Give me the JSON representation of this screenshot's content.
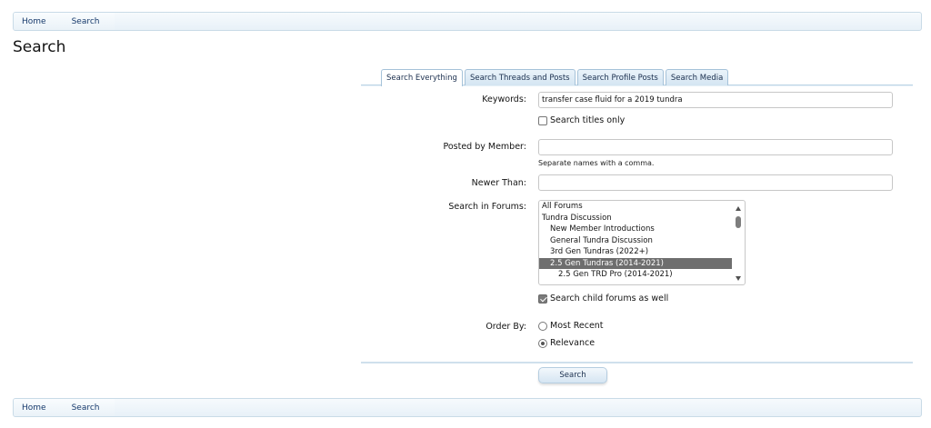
{
  "breadcrumb": {
    "home": "Home",
    "current": "Search"
  },
  "page_title": "Search",
  "tabs": [
    {
      "label": "Search Everything",
      "active": true
    },
    {
      "label": "Search Threads and Posts",
      "active": false
    },
    {
      "label": "Search Profile Posts",
      "active": false
    },
    {
      "label": "Search Media",
      "active": false
    }
  ],
  "form": {
    "keywords_label": "Keywords:",
    "keywords_value": "transfer case fluid for a 2019 tundra",
    "titles_only_label": "Search titles only",
    "titles_only_checked": false,
    "member_label": "Posted by Member:",
    "member_value": "",
    "member_hint": "Separate names with a comma.",
    "newer_label": "Newer Than:",
    "newer_value": "",
    "forums_label": "Search in Forums:",
    "forums": [
      {
        "label": "All Forums",
        "indent": 0,
        "selected": false
      },
      {
        "label": "Tundra Discussion",
        "indent": 0,
        "selected": false
      },
      {
        "label": "New Member Introductions",
        "indent": 1,
        "selected": false
      },
      {
        "label": "General Tundra Discussion",
        "indent": 1,
        "selected": false
      },
      {
        "label": "3rd Gen Tundras (2022+)",
        "indent": 1,
        "selected": false
      },
      {
        "label": "2.5 Gen Tundras (2014-2021)",
        "indent": 1,
        "selected": true
      },
      {
        "label": "2.5 Gen TRD Pro (2014-2021)",
        "indent": 2,
        "selected": false
      }
    ],
    "child_forums_label": "Search child forums as well",
    "child_forums_checked": true,
    "order_label": "Order By:",
    "order_most_recent": "Most Recent",
    "order_relevance": "Relevance",
    "order_selected": "Relevance",
    "submit_label": "Search"
  },
  "colors": {
    "selected_option": "#6e6e6e",
    "link": "#16396b"
  }
}
